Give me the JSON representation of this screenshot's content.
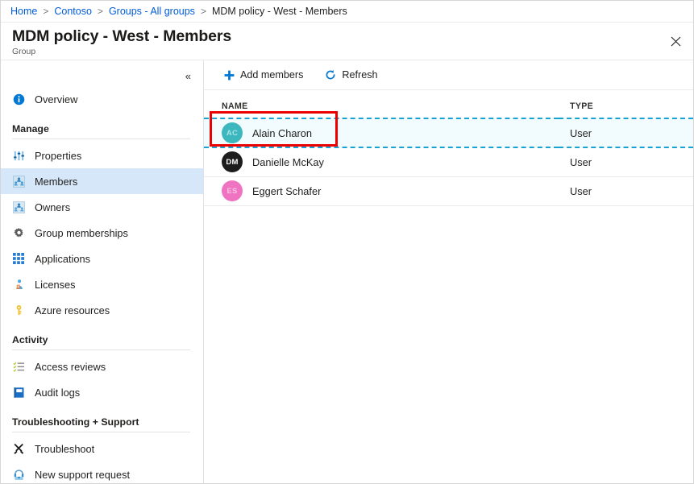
{
  "breadcrumb": {
    "items": [
      {
        "label": "Home",
        "link": true
      },
      {
        "label": "Contoso",
        "link": true
      },
      {
        "label": "Groups - All groups",
        "link": true
      },
      {
        "label": "MDM policy - West - Members",
        "link": false
      }
    ],
    "separator": ">"
  },
  "header": {
    "title": "MDM policy - West - Members",
    "subtitle": "Group",
    "close_icon": "close-icon"
  },
  "sidebar": {
    "collapse_icon": "«",
    "items": [
      {
        "label": "Overview",
        "icon": "info-icon",
        "selected": false
      },
      {
        "type": "group",
        "label": "Manage"
      },
      {
        "label": "Properties",
        "icon": "sliders-icon",
        "selected": false
      },
      {
        "label": "Members",
        "icon": "members-icon",
        "selected": true
      },
      {
        "label": "Owners",
        "icon": "owners-icon",
        "selected": false
      },
      {
        "label": "Group memberships",
        "icon": "gear-icon",
        "selected": false
      },
      {
        "label": "Applications",
        "icon": "grid-icon",
        "selected": false
      },
      {
        "label": "Licenses",
        "icon": "license-person-icon",
        "selected": false
      },
      {
        "label": "Azure resources",
        "icon": "key-icon",
        "selected": false
      },
      {
        "type": "group",
        "label": "Activity"
      },
      {
        "label": "Access reviews",
        "icon": "checklist-icon",
        "selected": false
      },
      {
        "label": "Audit logs",
        "icon": "book-icon",
        "selected": false
      },
      {
        "type": "group",
        "label": "Troubleshooting + Support"
      },
      {
        "label": "Troubleshoot",
        "icon": "wrench-screwdriver-icon",
        "selected": false
      },
      {
        "label": "New support request",
        "icon": "headset-icon",
        "selected": false
      }
    ]
  },
  "toolbar": {
    "add_members_label": "Add members",
    "add_members_icon": "plus-icon",
    "refresh_label": "Refresh",
    "refresh_icon": "refresh-icon"
  },
  "table": {
    "columns": [
      {
        "key": "name",
        "label": "NAME"
      },
      {
        "key": "type",
        "label": "TYPE"
      }
    ],
    "rows": [
      {
        "initials": "AC",
        "name": "Alain Charon",
        "type": "User",
        "avatar_color": "#3bb7bd",
        "selected": true
      },
      {
        "initials": "DM",
        "name": "Danielle McKay",
        "type": "User",
        "avatar_color": "#1d1d1d",
        "selected": false
      },
      {
        "initials": "ES",
        "name": "Eggert Schafer",
        "type": "User",
        "avatar_color": "#ef73c0",
        "selected": false
      }
    ]
  },
  "annotation": {
    "color": "#ec0000",
    "target": "Alain Charon row"
  },
  "colors": {
    "link": "#015cda",
    "accent": "#0078d4",
    "selected_nav_bg": "#d5e7f8",
    "selected_row_bg": "#f2fbfd",
    "selected_row_border": "#17a2d4"
  }
}
